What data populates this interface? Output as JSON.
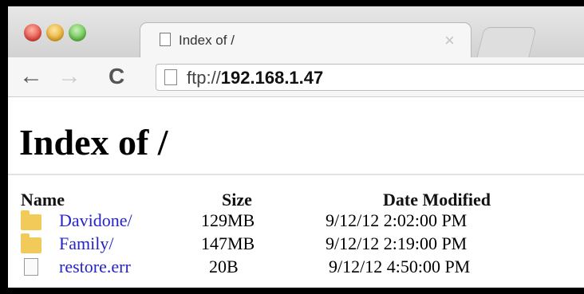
{
  "browser": {
    "tab_title": "Index of /",
    "tab_close": "×",
    "address": {
      "scheme": "ftp://",
      "host": "192.168.1.47"
    },
    "nav": {
      "back": "←",
      "forward": "→",
      "reload": "C"
    }
  },
  "page": {
    "heading": "Index of /",
    "columns": {
      "name": "Name",
      "size": "Size",
      "date": "Date Modified"
    },
    "rows": [
      {
        "name": "Davidone/",
        "size": "129MB",
        "date": "9/12/12 2:02:00 PM",
        "type": "folder-icon"
      },
      {
        "name": "Family/",
        "size": "147MB",
        "date": "9/12/12 2:19:00 PM",
        "type": "folder-icon"
      },
      {
        "name": "restore.err",
        "size": "20B",
        "date": "9/12/12 4:50:00 PM",
        "type": "file-icon"
      }
    ]
  }
}
